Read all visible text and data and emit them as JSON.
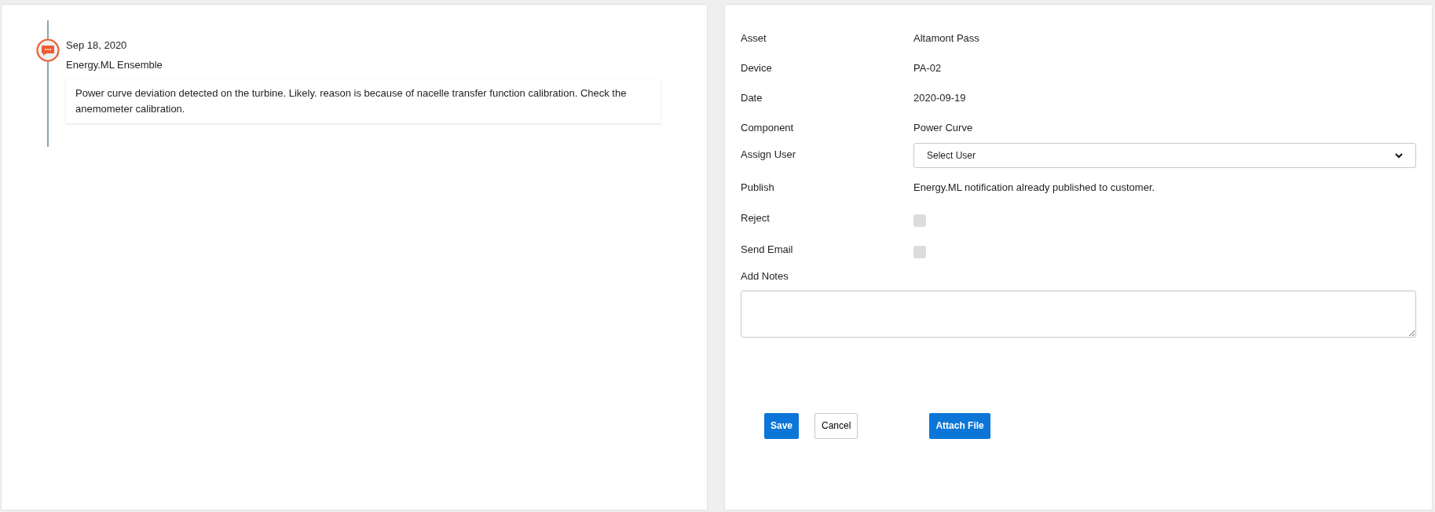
{
  "timeline": {
    "entries": [
      {
        "date": "Sep 18, 2020",
        "source": "Energy.ML Ensemble",
        "message": "Power curve deviation detected on the turbine. Likely. reason is because of nacelle transfer function calibration. Check the anemometer calibration."
      }
    ]
  },
  "form": {
    "fields": [
      {
        "kind": "text",
        "label": "Asset",
        "value": "Altamont Pass"
      },
      {
        "kind": "text",
        "label": "Device",
        "value": "PA-02"
      },
      {
        "kind": "text",
        "label": "Date",
        "value": "2020-09-19"
      },
      {
        "kind": "text",
        "label": "Component",
        "value": "Power Curve"
      },
      {
        "kind": "select",
        "label": "Assign User",
        "value": "Select User"
      },
      {
        "kind": "text",
        "label": "Publish",
        "value": "Energy.ML notification already published to customer."
      },
      {
        "kind": "checkbox",
        "label": "Reject",
        "checked": false,
        "disabled": true
      },
      {
        "kind": "checkbox",
        "label": "Send Email",
        "checked": false,
        "disabled": true
      }
    ],
    "notes": {
      "label": "Add Notes"
    },
    "buttons": [
      {
        "kind": "primary",
        "label": "Save"
      },
      {
        "kind": "secondary",
        "label": "Cancel"
      },
      {
        "kind": "primary",
        "label": "Attach File"
      }
    ]
  }
}
